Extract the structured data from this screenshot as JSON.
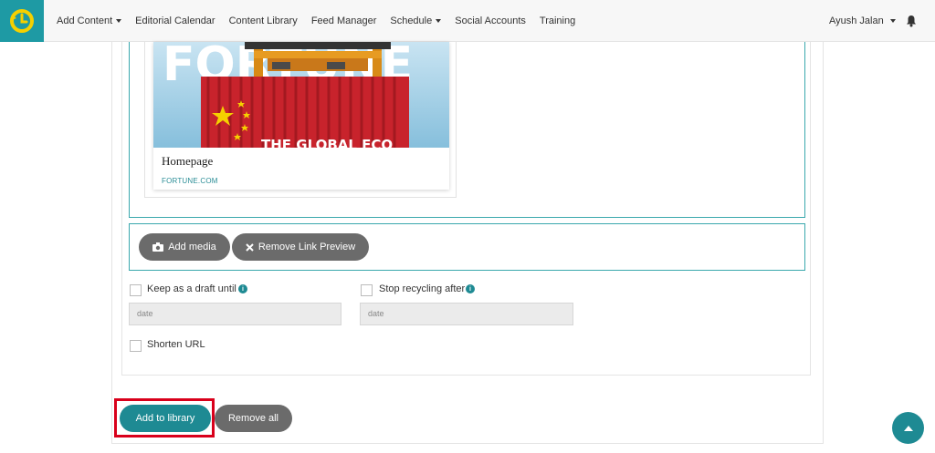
{
  "nav": {
    "items": [
      {
        "label": "Add Content",
        "dropdown": true
      },
      {
        "label": "Editorial Calendar",
        "dropdown": false
      },
      {
        "label": "Content Library",
        "dropdown": false
      },
      {
        "label": "Feed Manager",
        "dropdown": false
      },
      {
        "label": "Schedule",
        "dropdown": true
      },
      {
        "label": "Social Accounts",
        "dropdown": false
      },
      {
        "label": "Training",
        "dropdown": false
      }
    ],
    "user": "Ayush Jalan"
  },
  "link_preview": {
    "title": "Homepage",
    "domain": "FORTUNE.COM",
    "image_masthead": "FORTUNE",
    "image_headline": "THE GLOBAL ECO"
  },
  "media": {
    "add_media_label": "Add media",
    "remove_preview_label": "Remove Link Preview"
  },
  "options": {
    "draft_label": "Keep as a draft until",
    "draft_placeholder": "date",
    "recycle_label": "Stop recycling after",
    "recycle_placeholder": "date",
    "shorten_label": "Shorten URL"
  },
  "actions": {
    "add_label": "Add to library",
    "remove_all_label": "Remove all"
  },
  "colors": {
    "accent": "#1e8a93",
    "highlight": "#d9001b",
    "pill": "#6b6b6b"
  }
}
